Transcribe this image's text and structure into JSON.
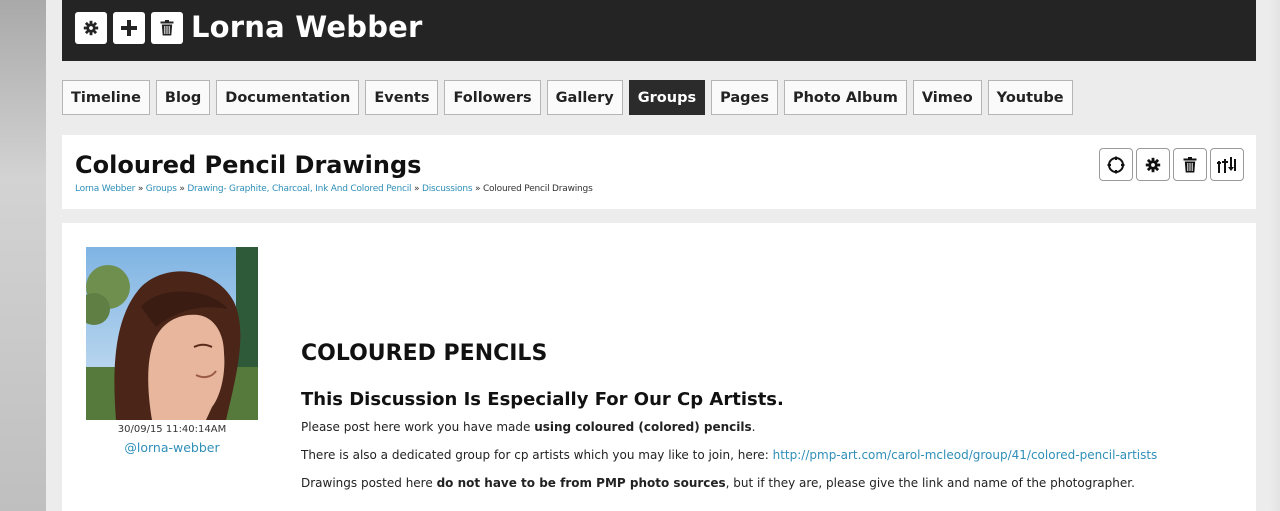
{
  "header": {
    "title": "Lorna Webber",
    "buttons": [
      {
        "icon": "gear-icon",
        "glyph": "✱"
      },
      {
        "icon": "plus-icon",
        "glyph": "+"
      },
      {
        "icon": "trash-icon",
        "glyph": "🗑"
      }
    ]
  },
  "tabs": [
    {
      "label": "Timeline",
      "active": false
    },
    {
      "label": "Blog",
      "active": false
    },
    {
      "label": "Documentation",
      "active": false
    },
    {
      "label": "Events",
      "active": false
    },
    {
      "label": "Followers",
      "active": false
    },
    {
      "label": "Gallery",
      "active": false
    },
    {
      "label": "Groups",
      "active": true
    },
    {
      "label": "Pages",
      "active": false
    },
    {
      "label": "Photo Album",
      "active": false
    },
    {
      "label": "Vimeo",
      "active": false
    },
    {
      "label": "Youtube",
      "active": false
    }
  ],
  "page": {
    "title": "Coloured Pencil Drawings",
    "breadcrumb": [
      {
        "label": "Lorna Webber",
        "link": true
      },
      {
        "label": "Groups",
        "link": true
      },
      {
        "label": "Drawing- Graphite, Charcoal, Ink And Colored Pencil",
        "link": true
      },
      {
        "label": "Discussions",
        "link": true
      },
      {
        "label": "Coloured Pencil Drawings",
        "link": false
      }
    ],
    "breadcrumb_sep": "»",
    "actions": [
      "target-icon",
      "gear-icon",
      "trash-icon",
      "sliders-icon"
    ]
  },
  "post": {
    "timestamp": "30/09/15 11:40:14AM",
    "author_handle": "@lorna-webber",
    "heading": "COLOURED PENCILS",
    "subheading": "This Discussion Is Especially For Our Cp Artists.",
    "p1_before": "Please post here work you have made ",
    "p1_bold": "using coloured (colored) pencils",
    "p1_after": ".",
    "p2_before": "There is also a dedicated group for cp artists which you may like to join, here: ",
    "p2_link": "http://pmp-art.com/carol-mcleod/group/41/colored-pencil-artists",
    "p3_before": "Drawings posted here ",
    "p3_bold": "do not have to be from PMP photo sources",
    "p3_after": ", but if they are, please give the link and name of the photographer."
  },
  "colors": {
    "header_bg": "#242424",
    "link": "#2f8fb8",
    "active_tab": "#2b2b2b",
    "emphasis_blue": "#2a2ad0"
  }
}
